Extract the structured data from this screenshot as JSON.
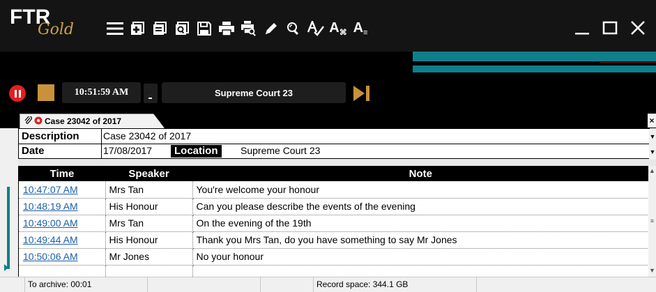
{
  "app": {
    "logo_main": "FTR",
    "logo_sub": "Gold"
  },
  "toolbar": {
    "icons": [
      "menu-icon",
      "new-session-icon",
      "open-session-icon",
      "search-session-icon",
      "save-icon",
      "print-icon",
      "print-preview-icon",
      "annotate-pen-icon",
      "zoom-search-icon",
      "spell-check-icon",
      "text-format-icon",
      "text-list-icon"
    ],
    "text_format_label": "A",
    "text_format_sub": "⌘",
    "text_list_label": "A",
    "text_list_sub": "≡"
  },
  "window": {
    "minimize": "—",
    "maximize": "☐",
    "close": "✕"
  },
  "transport": {
    "time": "10:51:59 AM",
    "location": "Supreme Court 23"
  },
  "tab": {
    "label": "Case 23042 of 2017",
    "close": "×"
  },
  "case": {
    "description_label": "Description",
    "description_value": "Case 23042 of 2017",
    "date_label": "Date",
    "date_value": "17/08/2017",
    "location_label": "Location",
    "location_value": "Supreme Court 23"
  },
  "notes": {
    "headers": {
      "time": "Time",
      "speaker": "Speaker",
      "note": "Note"
    },
    "rows": [
      {
        "time": "10:47:07 AM",
        "speaker": "Mrs Tan",
        "note": "You're welcome your honour"
      },
      {
        "time": "10:48:19 AM",
        "speaker": "His Honour",
        "note": "Can you please describe the events of the evening"
      },
      {
        "time": "10:49:00 AM",
        "speaker": "Mrs Tan",
        "note": "On the evening of the 19th"
      },
      {
        "time": "10:49:44 AM",
        "speaker": "His Honour",
        "note": "Thank you Mrs Tan, do you have something to say Mr Jones"
      },
      {
        "time": "10:50:06 AM",
        "speaker": "Mr Jones",
        "note": "No your honour"
      },
      {
        "time": "",
        "speaker": "",
        "note": ""
      }
    ]
  },
  "status": {
    "archive": "To archive: 00:01",
    "record_space": "Record space: 344.1 GB"
  },
  "colors": {
    "accent": "#0f7f8a",
    "record": "#e02020",
    "stop": "#c8923a",
    "gold": "#c9a24a",
    "link": "#1a5fa8"
  }
}
